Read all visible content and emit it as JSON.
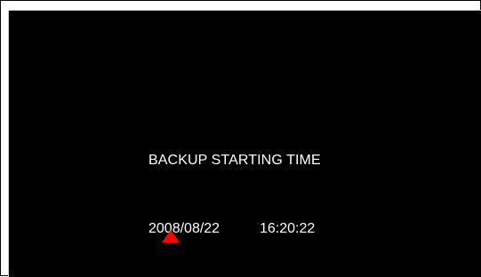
{
  "screen": {
    "heading": "BACKUP STARTING TIME",
    "date_value": "2008/08/22",
    "time_value": "16:20:22",
    "cursor_icon": "red-triangle-cursor",
    "colors": {
      "background": "#000000",
      "text": "#ffffff",
      "cursor": "#ff0000"
    }
  }
}
